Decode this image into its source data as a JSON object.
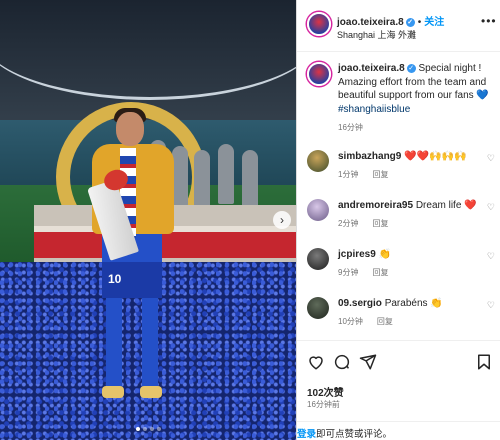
{
  "header": {
    "username": "joao.teixeira.8",
    "separator": "•",
    "follow_label": "关注",
    "location": "Shanghai 上海 外灘",
    "more_label": "•••"
  },
  "caption": {
    "username": "joao.teixeira.8",
    "text": "Special night ! Amazing effort from the team and beautiful support from our fans 💙",
    "hashtag": "#shanghaiisblue",
    "time": "16分钟"
  },
  "comments": [
    {
      "username": "simbazhang9",
      "text": "❤️❤️🙌🙌🙌",
      "time": "1分钟",
      "reply_label": "回复"
    },
    {
      "username": "andremoreira95",
      "text": "Dream life ❤️",
      "time": "2分钟",
      "reply_label": "回复"
    },
    {
      "username": "jcpires9",
      "text": "👏",
      "time": "9分钟",
      "reply_label": "回复"
    },
    {
      "username": "09.sergio",
      "text": "Parabéns 👏",
      "time": "10分钟",
      "reply_label": "回复"
    }
  ],
  "media": {
    "shorts_number": "10",
    "next_arrow": "›",
    "carousel_count": 4,
    "carousel_active_index": 0
  },
  "actions": {
    "icons": [
      "heart-icon",
      "comment-icon",
      "share-icon",
      "bookmark-icon"
    ],
    "likes": "102次赞",
    "time": "16分钟前"
  },
  "login_bar": {
    "link_label": "登录",
    "text": "即可点赞或评论。"
  },
  "colors": {
    "link_blue": "#0095f6",
    "hashtag": "#00376b",
    "muted": "#737373",
    "verified": "#3797f0"
  }
}
